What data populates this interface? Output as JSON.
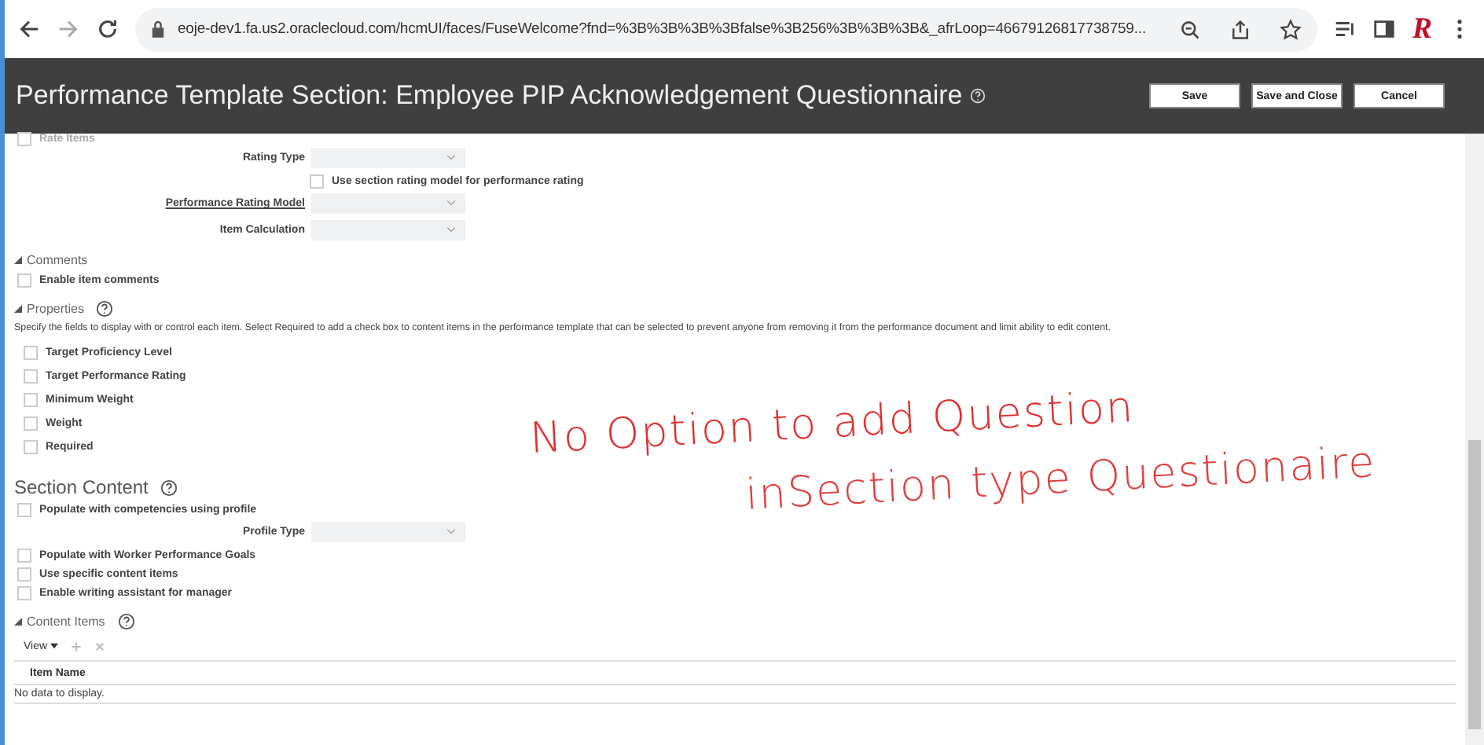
{
  "browser": {
    "url": "eoje-dev1.fa.us2.oraclecloud.com/hcmUI/faces/FuseWelcome?fnd=%3B%3B%3B%3Bfalse%3B256%3B%3B%3B&_afrLoop=46679126817738759...",
    "profile_letter": "R"
  },
  "header": {
    "title": "Performance Template Section: Employee PIP Acknowledgement Questionnaire",
    "buttons": [
      "Save",
      "Save and Close",
      "Cancel"
    ]
  },
  "rate_items": {
    "label": "Rate Items",
    "checked": false
  },
  "rating_fields": [
    {
      "kind": "select",
      "label": "Rating Type",
      "underlined": false
    },
    {
      "kind": "checkbox",
      "label": "Use section rating model for performance rating",
      "checked": false
    },
    {
      "kind": "select",
      "label": "Performance Rating Model",
      "underlined": true
    },
    {
      "kind": "select",
      "label": "Item Calculation",
      "underlined": false
    }
  ],
  "comments": {
    "title": "Comments",
    "expanded": true,
    "options": [
      {
        "label": "Enable item comments",
        "checked": false
      }
    ]
  },
  "properties": {
    "title": "Properties",
    "expanded": true,
    "description": "Specify the fields to display with or control each item. Select Required to add a check box to content items in the performance template that can be selected to prevent anyone from removing it from the performance document and limit ability to edit content.",
    "options": [
      {
        "label": "Target Proficiency Level",
        "checked": false
      },
      {
        "label": "Target Performance Rating",
        "checked": false
      },
      {
        "label": "Minimum Weight",
        "checked": false
      },
      {
        "label": "Weight",
        "checked": false
      },
      {
        "label": "Required",
        "checked": false
      }
    ]
  },
  "section_content": {
    "title": "Section Content",
    "populate": {
      "label": "Populate with competencies using profile",
      "checked": false
    },
    "profile_type_label": "Profile Type",
    "options": [
      {
        "label": "Populate with Worker Performance Goals",
        "checked": false
      },
      {
        "label": "Use specific content items",
        "checked": false
      },
      {
        "label": "Enable writing assistant for manager",
        "checked": false
      }
    ]
  },
  "content_items": {
    "title": "Content Items",
    "expanded": true,
    "view_label": "View",
    "columns": [
      "Item Name"
    ],
    "empty_text": "No data to display."
  },
  "annotation": {
    "lines": [
      "No Option to add Question",
      "inSection type Questionaire"
    ]
  }
}
